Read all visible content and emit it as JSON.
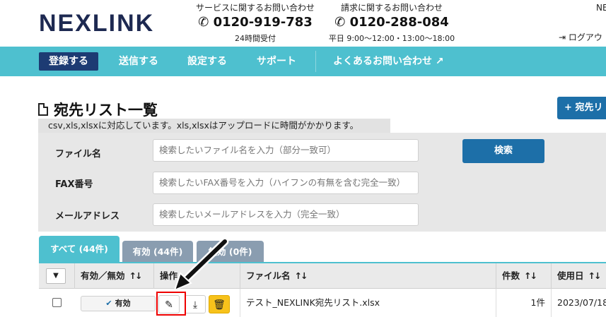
{
  "header": {
    "logo": "NEXLINK",
    "service_contact": {
      "label": "サービスに関するお問い合わせ",
      "phone": "0120-919-783",
      "hours": "24時間受付"
    },
    "billing_contact": {
      "label": "請求に関するお問い合わせ",
      "phone": "0120-288-084",
      "hours": "平日 9:00～12:00・13:00～18:00"
    },
    "user_partial": "NE",
    "logout": "ログアウ"
  },
  "nav": {
    "items": [
      "登録する",
      "送信する",
      "設定する",
      "サポート"
    ],
    "faq": "よくあるお問い合わせ"
  },
  "page": {
    "title": "宛先リスト一覧",
    "add_button": "宛先リ",
    "note": "csv,xls,xlsxに対応しています。xls,xlsxはアップロードに時間がかかります。"
  },
  "search": {
    "file_label": "ファイル名",
    "file_placeholder": "検索したいファイル名を入力（部分一致可）",
    "fax_label": "FAX番号",
    "fax_placeholder": "検索したいFAX番号を入力（ハイフンの有無を含む完全一致）",
    "mail_label": "メールアドレス",
    "mail_placeholder": "検索したいメールアドレスを入力（完全一致）",
    "search_button": "検索"
  },
  "tabs": [
    "すべて (44件)",
    "有効 (44件)",
    "無効 (0件)"
  ],
  "table": {
    "headers": [
      "有効／無効",
      "操作",
      "ファイル名",
      "件数",
      "使用日"
    ],
    "sort_symbol": "↑↓",
    "rows": [
      {
        "status": "有効",
        "file": "テスト_NEXLINK宛先リスト.xlsx",
        "count": "1件",
        "date": "2023/07/18("
      }
    ]
  },
  "colors": {
    "nav": "#4ec0cf",
    "primary": "#1d6fa8",
    "delete": "#f7c21b",
    "highlight": "#ee0000"
  }
}
